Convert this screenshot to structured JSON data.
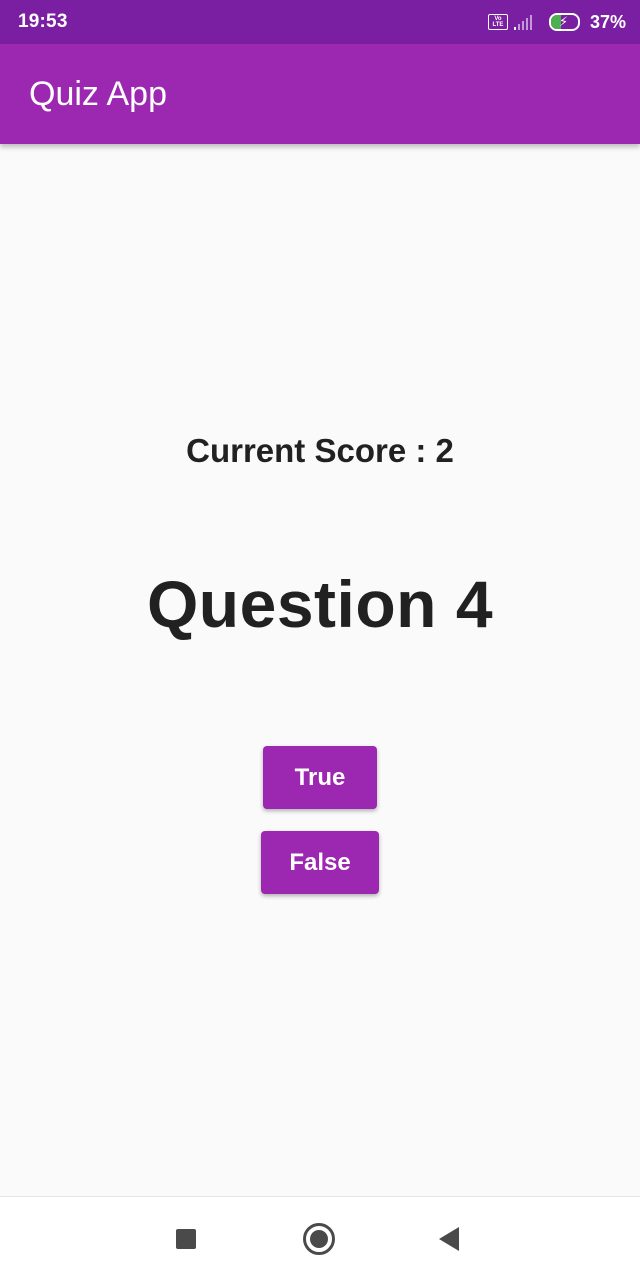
{
  "status_bar": {
    "time": "19:53",
    "volte_top": "Vo",
    "volte_bottom": "LTE",
    "battery_percent": "37%",
    "battery_level": 0.37,
    "battery_charging": true
  },
  "app_bar": {
    "title": "Quiz App"
  },
  "quiz": {
    "score_text": "Current Score : 2",
    "question_text": "Question 4",
    "true_label": "True",
    "false_label": "False"
  },
  "nav_bar": {
    "recent_icon": "square-icon",
    "home_icon": "circle-icon",
    "back_icon": "triangle-left-icon"
  },
  "colors": {
    "primary": "#9c27b0",
    "primary_dark": "#7b1fa2",
    "background": "#fafafa",
    "text": "#212121"
  }
}
